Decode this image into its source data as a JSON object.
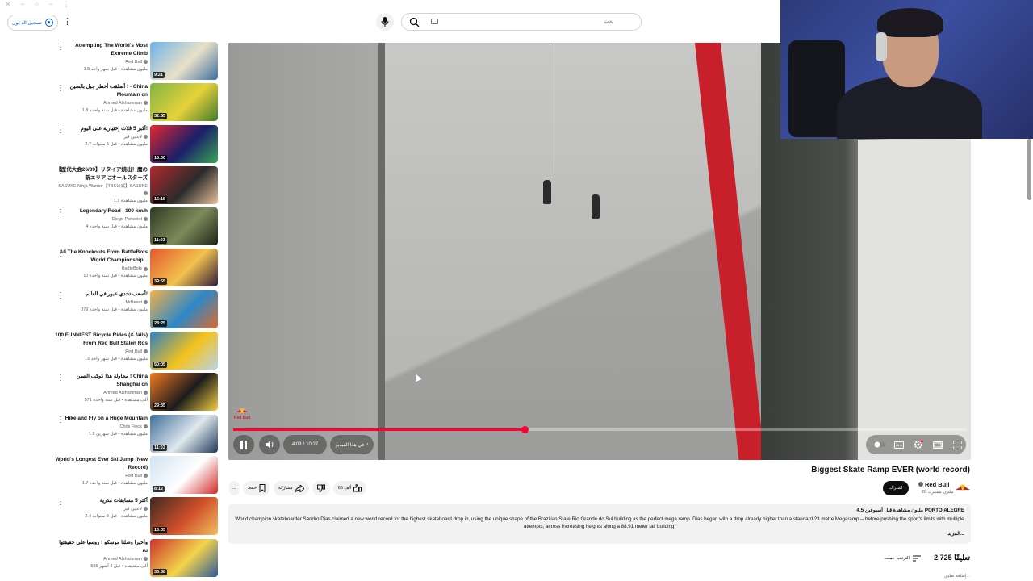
{
  "header": {
    "signin_label": "تسجيل الدخول",
    "search_placeholder": "بحث"
  },
  "recommendations": [
    {
      "title": "Attempting The World's Most Extreme Climb",
      "channel": "Red Bull",
      "stats": "1.5 مليون مشاهدة • قبل شهر واحد",
      "duration": "9:21",
      "thumb_colors": [
        "#6fb2e8",
        "#e9e1c6",
        "#3b6fa0"
      ]
    },
    {
      "title": "أصلقت أخطر جبل بالصين ! - China Mountain cn",
      "channel": "Ahmed Alshamman",
      "stats": "1.8 مليون مشاهدة • قبل سنة واحدة",
      "duration": "32:55",
      "thumb_colors": [
        "#7fb542",
        "#e6d23a",
        "#3f7a2c"
      ]
    },
    {
      "title": "أكبر 5 ڤلات إختيارية على اليوم!",
      "channel": "لاعبين ڤيز",
      "stats": "2.7 مليون مشاهدة • قبل 5 سنوات",
      "duration": "15:00",
      "thumb_colors": [
        "#e5282d",
        "#1a1f6a",
        "#3aa652"
      ]
    },
    {
      "title": "【歴代大会26/39】リタイア続出！魔の新エリアにオールスターズ",
      "channel": "SASUKE Ninja Warrior【TBS公式】SASUKE",
      "stats": "1.1 مليون مشاهدة",
      "duration": "16:15",
      "thumb_colors": [
        "#b22a2f",
        "#2b2b2b",
        "#e8c19a"
      ]
    },
    {
      "title": "Legendary Road | 100 km/h",
      "channel": "Diego Poncelet",
      "stats": "4 مليون مشاهدة • قبل سنة واحدة",
      "duration": "11:03",
      "thumb_colors": [
        "#2f3a22",
        "#7c8b5a",
        "#1c2214"
      ]
    },
    {
      "title": "All The Knockouts From BattleBots World Championship...",
      "channel": "BattleBots",
      "stats": "10 مليون مشاهدة • قبل سنة واحدة",
      "duration": "39:55",
      "thumb_colors": [
        "#e4572e",
        "#f2c14e",
        "#2e1b3a"
      ]
    },
    {
      "title": "أصعب تحدي عبور في العالم!",
      "channel": "MrBeast",
      "stats": "379 مليون مشاهدة • قبل سنة واحدة",
      "duration": "28:25",
      "thumb_colors": [
        "#f2b24a",
        "#2d88c8",
        "#e06a2a"
      ]
    },
    {
      "title": "100 FUNNIEST Bicycle Rides (& fails) From Red Bull Stalen Ros",
      "channel": "Red Bull",
      "stats": "15 مليون مشاهدة • قبل شهر واحد",
      "duration": "50:05",
      "thumb_colors": [
        "#2f7fc0",
        "#f3c31c",
        "#b7d4e8"
      ]
    },
    {
      "title": "محاولة هذا كوكب الصين ! China Shanghai cn",
      "channel": "Ahmed Alshamman",
      "stats": "571 ألف مشاهدة • قبل سنة واحدة",
      "duration": "29:35",
      "thumb_colors": [
        "#f07b1f",
        "#1c1c1c",
        "#f5d142"
      ]
    },
    {
      "title": "Hike and Fly on a Huge Mountain",
      "channel": "Chris Finck",
      "stats": "1.9 مليون مشاهدة • قبل شهرين",
      "duration": "11:03",
      "thumb_colors": [
        "#3f6e99",
        "#dfe7ee",
        "#1e3a57"
      ]
    },
    {
      "title": "World's Longest Ever Ski Jump (New Record)",
      "channel": "Red Bull",
      "stats": "1.7 مليون مشاهدة • قبل سنة واحدة",
      "duration": "8:12",
      "thumb_colors": [
        "#cfe3f2",
        "#ffffff",
        "#d22a2a"
      ]
    },
    {
      "title": "أكثر 5 مسابقات مدرية",
      "channel": "لاعبين ڤيز",
      "stats": "2.4 مليون مشاهدة • قبل 5 سنوات",
      "duration": "16:05",
      "thumb_colors": [
        "#3a2a22",
        "#d04f2a",
        "#f0c060"
      ]
    },
    {
      "title": "وأخيرا وصلنا موسكو ! روسيا على حقيقتها ru",
      "channel": "Ahmed Alshamman",
      "stats": "555 ألف مشاهدة • قبل 4 أشهر",
      "duration": "35:38",
      "thumb_colors": [
        "#c9322c",
        "#f3d34a",
        "#2a5a9c"
      ]
    }
  ],
  "player": {
    "current_time": "4:09",
    "total_time": "10:27",
    "time_separator": "/",
    "chapter_label": "في هذا الفيديو",
    "progress_fraction": 0.398,
    "watermark": "Red Bull",
    "accent": "#ff0033"
  },
  "video": {
    "title": "Biggest Skate Ramp EVER (world record)",
    "channel": "Red Bull",
    "subscribers": "26 مليون مشترك",
    "subscribe_label": "اشتراك",
    "likes": "65 ألف",
    "share_label": "مشاركة",
    "save_label": "حفظ",
    "more_label": "...",
    "description_meta": "4.5 مليون مشاهدة قبل أسبوعين PORTO ALEGRE",
    "description_body": "World champion skateboarder Sandro Dias claimed a new world record for the highest skateboard drop in, using the unique shape of the Brazilian State Rio Grande do Sul building as the perfect mega ramp. Dias began with a drop already higher than a standard 23 metre Megaramp -- before pushing the sport's limits with multiple attempts, across increasing heights along a 88.91 meter tall building.",
    "description_more": "المزيد..."
  },
  "comments": {
    "count": "2,725",
    "label": "تعليقًا",
    "sort_label": "الترتيب حسب",
    "add_placeholder": "إضافة تعليق..."
  }
}
